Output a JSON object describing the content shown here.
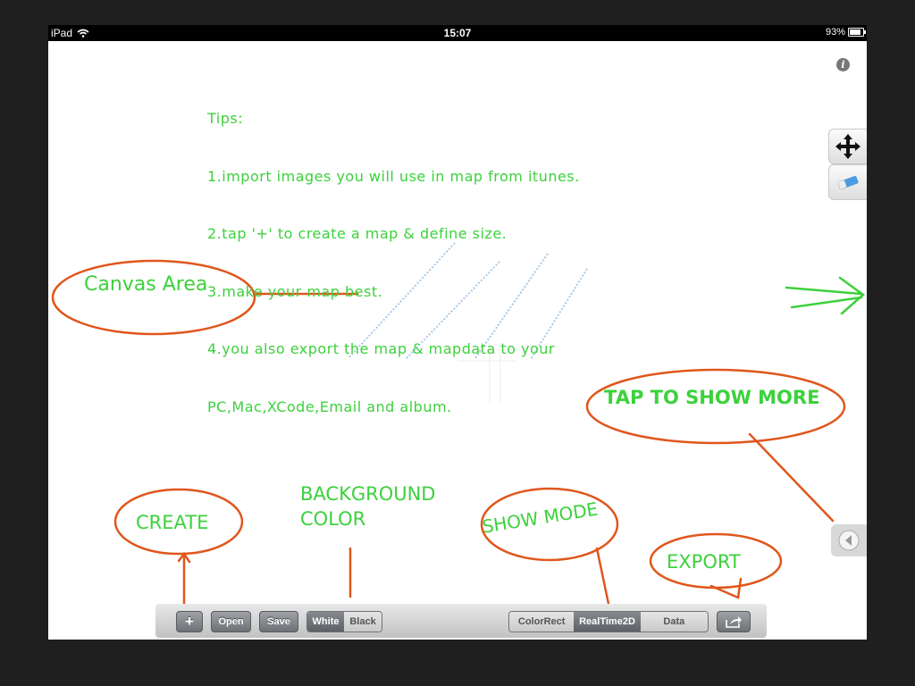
{
  "status_bar": {
    "device": "iPad",
    "time": "15:07",
    "battery": "93%"
  },
  "tips": [
    "Tips:",
    "1.import images you will use in map from itunes.",
    "2.tap '+' to create a map & define size.",
    "3.make your map best.",
    "4.you also export the map & mapdata to your",
    "PC,Mac,XCode,Email and album."
  ],
  "annotations": {
    "canvas_area": "Canvas Area",
    "tap_to_show_more": "TAP TO SHOW MORE",
    "create": "CREATE",
    "background_color": "BACKGROUND\nCOLOR",
    "show_mode": "SHOW MODE",
    "export": "EXPORT"
  },
  "icons": {
    "info": "info-icon",
    "move": "move-arrows-icon",
    "eraser": "eraser-icon",
    "show_more": "chevron-left-icon",
    "export": "share-icon"
  },
  "toolbar": {
    "add_label": "+",
    "open_label": "Open",
    "save_label": "Save",
    "background": {
      "options": [
        "White",
        "Black"
      ],
      "selected": "White"
    },
    "modes": {
      "options": [
        "ColorRect",
        "RealTime2D",
        "Data"
      ],
      "selected": "RealTime2D"
    }
  },
  "colors": {
    "handwriting": "#3cd13c",
    "annotation_stroke": "#e0561c",
    "sketch": "#a9c8e8"
  }
}
